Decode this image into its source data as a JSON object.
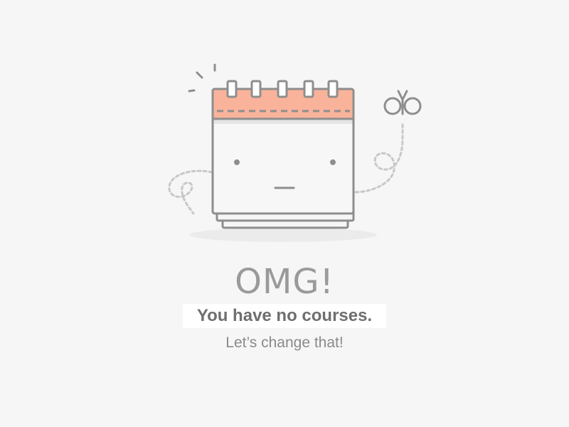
{
  "empty_state": {
    "headline": "OMG!",
    "message": "You have no courses.",
    "call_to_action": "Let’s change that!"
  },
  "illustration": {
    "icon": "calendar-face-icon",
    "companion_icon": "butterfly-icon",
    "accent_color": "#f9b39a",
    "line_color": "#8e8e8e",
    "trail_color": "#c8c8c8"
  }
}
